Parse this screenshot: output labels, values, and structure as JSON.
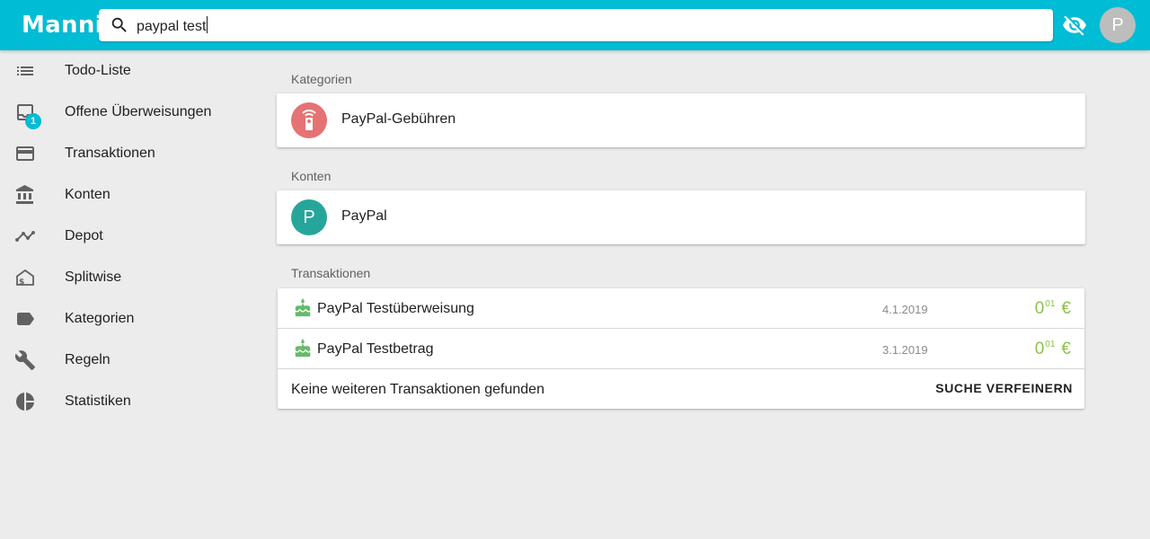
{
  "app": {
    "logo": "Manni"
  },
  "search": {
    "value": "paypal test"
  },
  "header": {
    "visibility_icon": "eye-off-icon",
    "avatar_letter": "P"
  },
  "sidebar": {
    "items": [
      {
        "label": "Todo-Liste",
        "icon": "list-icon"
      },
      {
        "label": "Offene Überweisungen",
        "icon": "inbox-icon",
        "badge": "1"
      },
      {
        "label": "Transaktionen",
        "icon": "credit-card-icon"
      },
      {
        "label": "Konten",
        "icon": "bank-icon"
      },
      {
        "label": "Depot",
        "icon": "trending-icon"
      },
      {
        "label": "Splitwise",
        "icon": "splitwise-icon"
      },
      {
        "label": "Kategorien",
        "icon": "label-icon"
      },
      {
        "label": "Regeln",
        "icon": "wrench-icon"
      },
      {
        "label": "Statistiken",
        "icon": "pie-chart-icon"
      }
    ]
  },
  "results": {
    "categories": {
      "heading": "Kategorien",
      "items": [
        {
          "label": "PayPal-Gebühren",
          "icon": "remote-icon",
          "color": "#e57373"
        }
      ]
    },
    "accounts": {
      "heading": "Konten",
      "items": [
        {
          "label": "PayPal",
          "avatar_letter": "P",
          "color": "#26a69a"
        }
      ]
    },
    "transactions": {
      "heading": "Transaktionen",
      "items": [
        {
          "label": "PayPal Testüberweisung",
          "date": "4.1.2019",
          "amount_whole": "0",
          "amount_cents": "01",
          "currency": "€",
          "icon": "cake-icon"
        },
        {
          "label": "PayPal Testbetrag",
          "date": "3.1.2019",
          "amount_whole": "0",
          "amount_cents": "01",
          "currency": "€",
          "icon": "cake-icon"
        }
      ],
      "footer_message": "Keine weiteren Transaktionen gefunden",
      "refine_button": "SUCHE VERFEINERN"
    }
  },
  "colors": {
    "primary": "#00bcd4",
    "positive_amount": "#8bc34a",
    "background": "#ececec"
  }
}
